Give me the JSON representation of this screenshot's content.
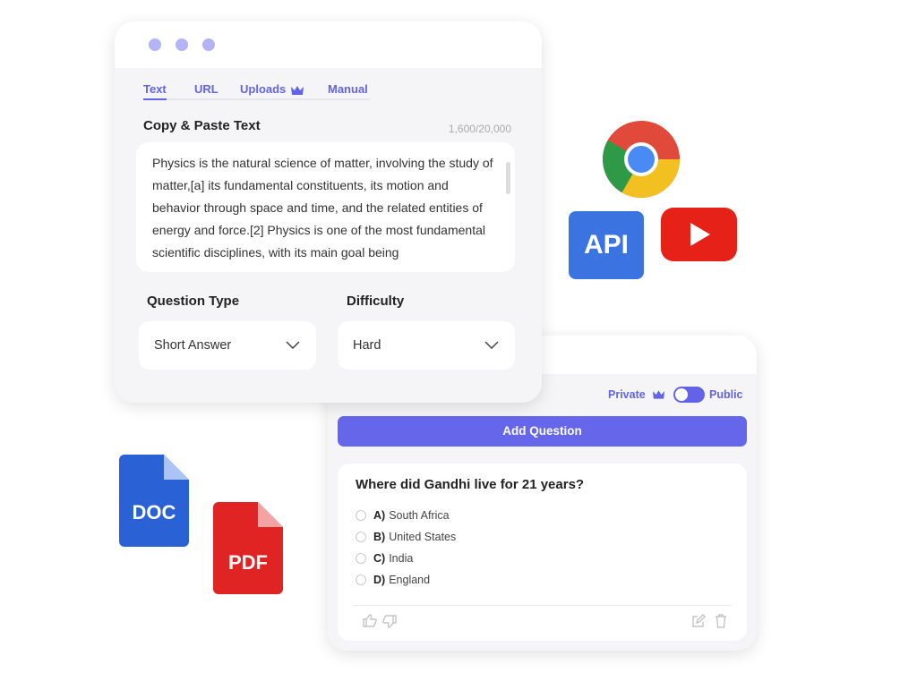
{
  "input_card": {
    "tabs": [
      {
        "label": "Text",
        "active": true
      },
      {
        "label": "URL"
      },
      {
        "label": "Uploads",
        "icon": "crown-icon"
      },
      {
        "label": "Manual"
      }
    ],
    "text_label": "Copy & Paste Text",
    "char_count": "1,600/20,000",
    "text_value": "Physics is the natural science of matter, involving the study of matter,[a] its fundamental constituents, its motion and behavior through  space and time, and the related entities of energy and force.[2] Physics is one of the most fundamental scientific disciplines, with its main goal being",
    "question_type": {
      "label": "Question Type",
      "value": "Short Answer"
    },
    "difficulty": {
      "label": "Difficulty",
      "value": "Hard"
    }
  },
  "question_card": {
    "private_label": "Private",
    "public_label": "Public",
    "add_button": "Add Question",
    "question": "Where did Gandhi live for 21 years?",
    "options": [
      {
        "key": "A)",
        "text": "South Africa"
      },
      {
        "key": "B)",
        "text": "United States"
      },
      {
        "key": "C)",
        "text": "India"
      },
      {
        "key": "D)",
        "text": "England"
      }
    ]
  },
  "logos": {
    "api": "API",
    "doc": "DOC",
    "pdf": "PDF"
  },
  "colors": {
    "accent": "#6666ea",
    "doc": "#2a62d6",
    "pdf": "#e02424",
    "youtube": "#e62117",
    "api": "#3b73e0"
  }
}
